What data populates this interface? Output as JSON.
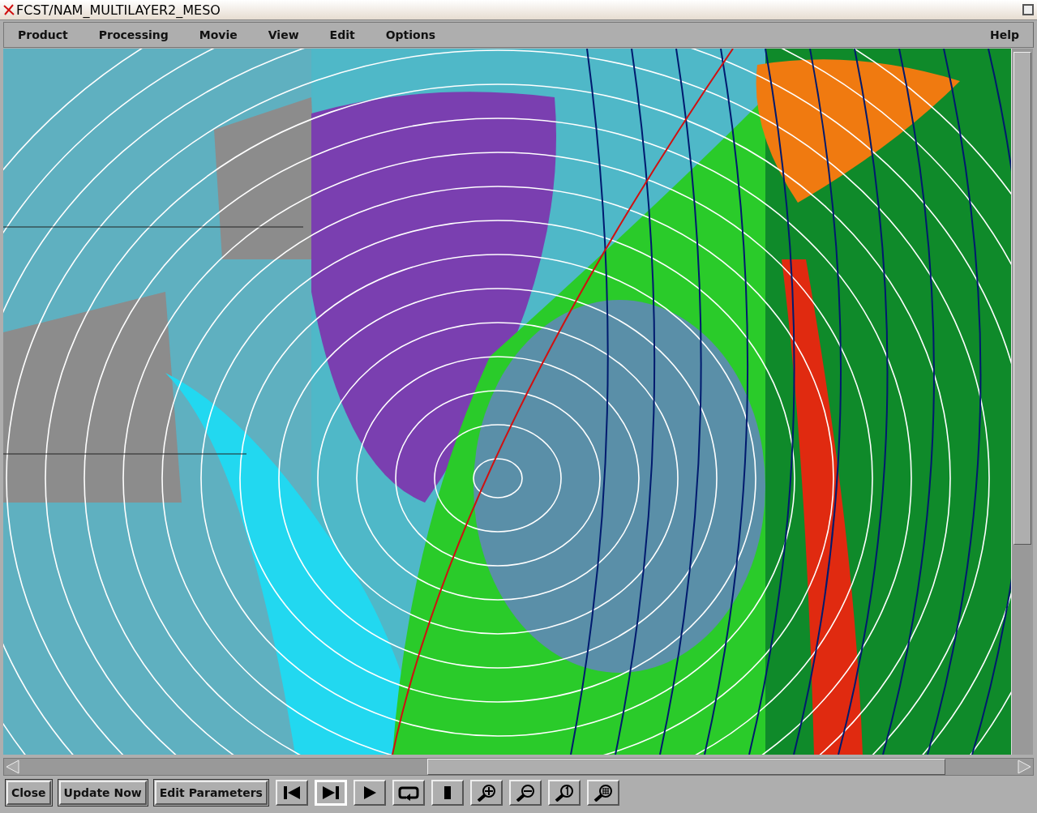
{
  "window": {
    "title": "FCST/NAM_MULTILAYER2_MESO"
  },
  "menu": [
    {
      "label": "Product"
    },
    {
      "label": "Processing"
    },
    {
      "label": "Movie"
    },
    {
      "label": "View"
    },
    {
      "label": "Edit"
    },
    {
      "label": "Options"
    }
  ],
  "help_menu": {
    "label": "Help"
  },
  "buttons": [
    {
      "label": "Close"
    },
    {
      "label": "Update Now"
    },
    {
      "label": "Edit Parameters"
    }
  ],
  "tools": [
    {
      "kind": "first",
      "selected": false
    },
    {
      "kind": "last",
      "selected": true
    },
    {
      "kind": "play",
      "selected": false
    },
    {
      "kind": "loop",
      "selected": false
    },
    {
      "kind": "stop",
      "selected": false
    },
    {
      "kind": "zoom-in",
      "selected": false
    },
    {
      "kind": "zoom-out",
      "selected": false
    },
    {
      "kind": "zoom-one",
      "selected": false
    },
    {
      "kind": "zoom-grid",
      "selected": false
    }
  ]
}
